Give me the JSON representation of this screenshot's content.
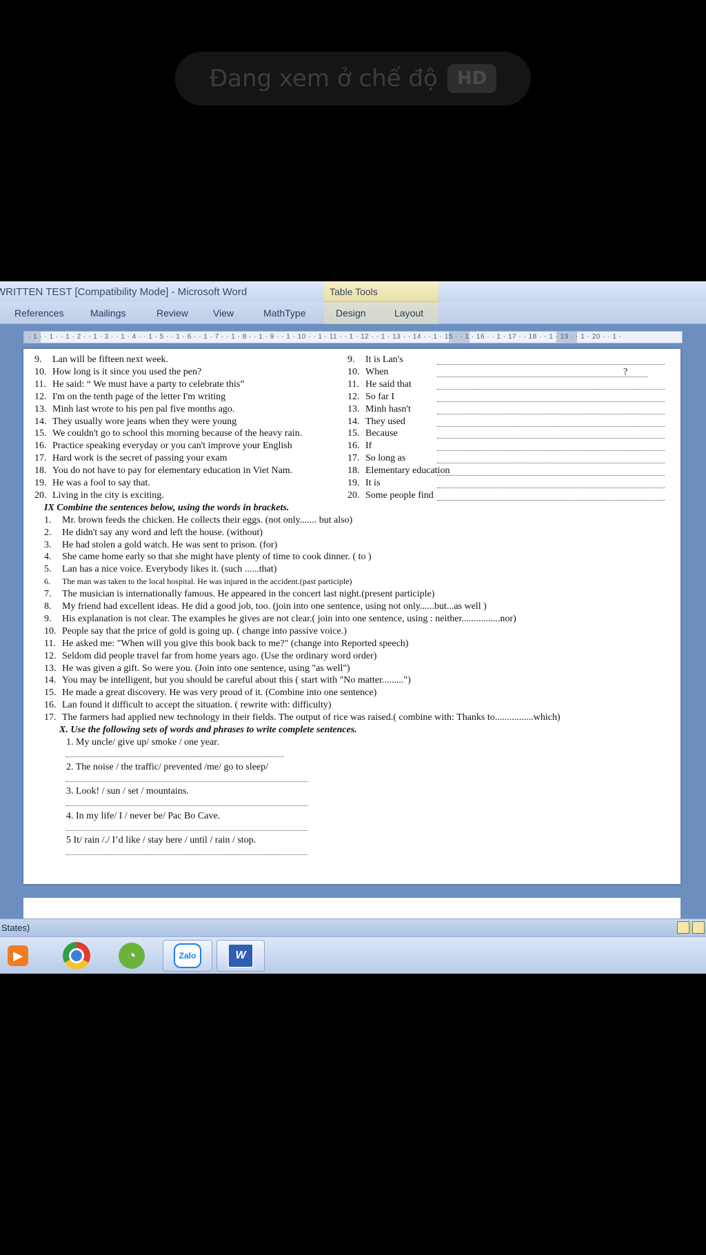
{
  "overlay": {
    "text": "Đang xem ở chế độ",
    "badge": "HD"
  },
  "window": {
    "title": "WRITTEN TEST [Compatibility Mode] - Microsoft Word",
    "contextual_group": "Table Tools"
  },
  "ribbon": {
    "tabs": [
      "References",
      "Mailings",
      "Review",
      "View",
      "MathType",
      "Design",
      "Layout"
    ]
  },
  "ruler": {
    "text": "· 1 · · 1 · · 1 · 2 · · 1 · 3 · · 1 · 4 · · 1 · 5 · · 1 · 6 · · 1 · 7 · · 1 · 8 · · 1 · 9 · · 1 · 10 · · 1 · 11 · · 1 · 12 · · 1 · 13 · · 14 · · 1 · 15 · · 1 · 16 · · 1 · 17 · · 18 · · 1 · 19 · · 1 · 20 · · 1 ·"
  },
  "document": {
    "left_items": [
      {
        "n": "9.",
        "t": "Lan will be fifteen next week."
      },
      {
        "n": "10.",
        "t": "How long is it since you used the pen?"
      },
      {
        "n": "11.",
        "t": "He said: “ We must have a party to celebrate this”"
      },
      {
        "n": "12.",
        "t": "I'm on the tenth page of the letter I'm writing"
      },
      {
        "n": "13.",
        "t": "Minh last wrote to his pen pal five months ago."
      },
      {
        "n": "14.",
        "t": "They usually wore jeans when they were young"
      },
      {
        "n": "15.",
        "t": "We couldn't go to school this morning because of the heavy rain."
      },
      {
        "n": "16.",
        "t": "Practice speaking everyday or you can't improve your English"
      },
      {
        "n": "17.",
        "t": "Hard work is the secret of passing your exam"
      },
      {
        "n": "18.",
        "t": "You do not have to pay for elementary  education in Viet Nam."
      },
      {
        "n": "19.",
        "t": "He was a fool to say that."
      },
      {
        "n": "20.",
        "t": "Living in the city is exciting."
      }
    ],
    "right_items": [
      {
        "n": "9.",
        "t": "It is Lan's"
      },
      {
        "n": "10.",
        "t": "When",
        "end": "?"
      },
      {
        "n": "11.",
        "t": "He said that"
      },
      {
        "n": "12.",
        "t": "So far I"
      },
      {
        "n": "13.",
        "t": "Minh hasn't"
      },
      {
        "n": "14.",
        "t": "They used"
      },
      {
        "n": "15.",
        "t": "Because"
      },
      {
        "n": "16.",
        "t": "If"
      },
      {
        "n": "17.",
        "t": "So long as"
      },
      {
        "n": "18.",
        "t": "Elementary  education"
      },
      {
        "n": "19.",
        "t": "It is"
      },
      {
        "n": "20.",
        "t": "Some people find"
      }
    ],
    "section_ix_title": "IX Combine the sentences below, using the words in brackets.",
    "section_ix_items": [
      {
        "n": "1.",
        "t": "Mr. brown feeds the chicken. He collects their eggs. (not only....... but also)"
      },
      {
        "n": "2.",
        "t": "He didn't say any word and left the house.                (without)"
      },
      {
        "n": "3.",
        "t": "He had stolen a gold watch. He was sent to prison.              (for)"
      },
      {
        "n": "4.",
        "t": "She came home early so that she might have plenty of time to cook dinner.   ( to )"
      },
      {
        "n": "5.",
        "t": "Lan has a nice voice. Everybody likes it.              (such ......that)"
      },
      {
        "n": "6.",
        "t": "The man was taken to the local hospital. He was injured in the accident.(past participle)"
      },
      {
        "n": "7.",
        "t": "The musician is internationally  famous. He appeared  in the concert last night.(present participle)"
      },
      {
        "n": "8.",
        "t": "My friend had excellent ideas. He did a good job, too. (join into one sentence, using not only......but...as well )"
      },
      {
        "n": "9.",
        "t": "His explanation is not clear. The examples he gives are not clear.( join into one sentence,  using  : neither................nor)"
      },
      {
        "n": "10.",
        "t": "People say that the price of gold is going up. ( change into passive voice.)"
      },
      {
        "n": "11.",
        "t": "He asked me: \"When will you give this book back to me?\"              (change into Reported speech)"
      },
      {
        "n": "12.",
        "t": "Seldom did people travel far from home years ago.              (Use the ordinary word order)"
      },
      {
        "n": "13.",
        "t": "He was given a gift. So were you.            (Join into one sentence, using \"as well\")"
      },
      {
        "n": "14.",
        "t": "You may be intelligent,  but you should be careful about this ( start with \"No matter.........\")"
      },
      {
        "n": "15.",
        "t": "He made a great discovery. He was very proud of it.          (Combine into one sentence)"
      },
      {
        "n": "16.",
        "t": "Lan found it difficult to accept the situation. ( rewrite with: difficulty)"
      },
      {
        "n": "17.",
        "t": "The farmers had applied new technology in their fields. The output of rice was raised.( combine with: Thanks to................which)"
      }
    ],
    "section_x_title": "X.  Use the following sets of words and phrases to write complete sentences.",
    "section_x_items": [
      "1.    My uncle/ give up/ smoke / one year.",
      "2.    The noise / the traffic/ prevented  /me/ go to sleep/",
      "3. Look! / sun / set / mountains.",
      "4.  In my life/ I / never be/ Pac Bo Cave.",
      "5 It/ rain /./ I’d like / stay here / until / rain / stop."
    ]
  },
  "status": {
    "text": "States)"
  },
  "taskbar": {
    "zalo_label": "Zalo",
    "word_label": "W"
  }
}
